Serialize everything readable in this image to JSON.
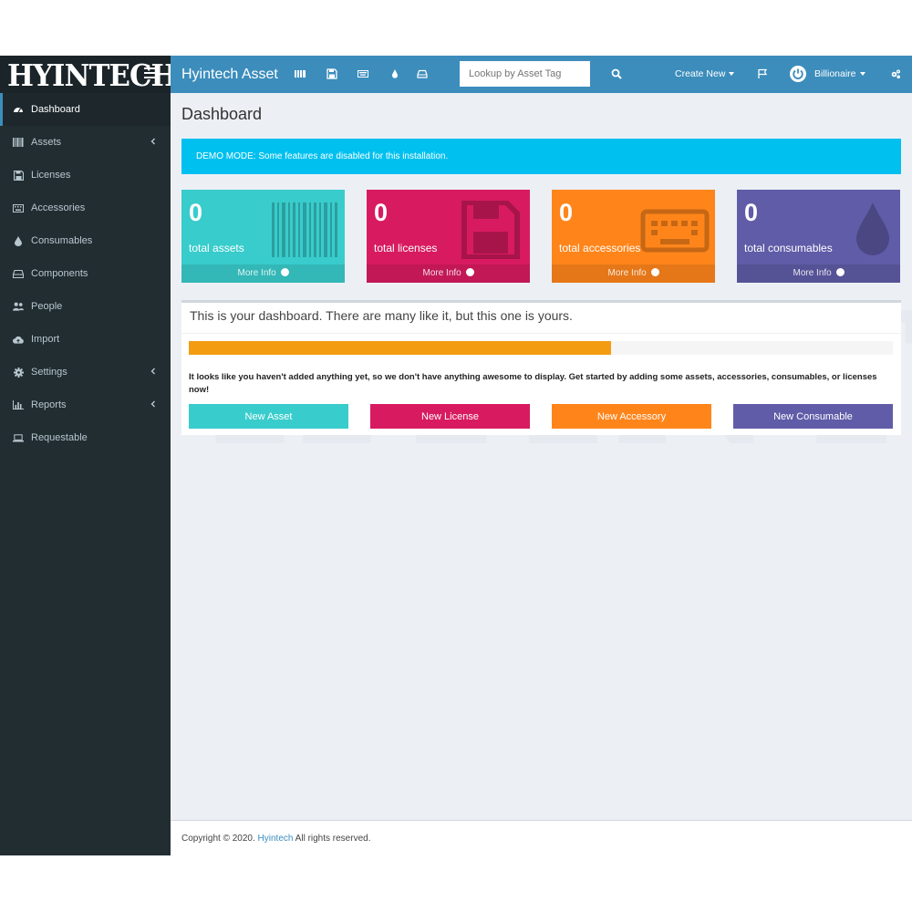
{
  "brand": {
    "logo_text": "HYINTECH",
    "app_title": "Hyintech Asset"
  },
  "colors": {
    "sidebar_bg": "#222d32",
    "header_bg": "#3c8dbc",
    "teal": "#39cccc",
    "pink": "#d81b60",
    "orange": "#ff851b",
    "purple": "#605ca8",
    "info": "#00c0ef",
    "progress": "#f39c12"
  },
  "sidebar": {
    "items": [
      {
        "label": "Dashboard",
        "icon": "dashboard-icon",
        "active": true,
        "has_chevron": false
      },
      {
        "label": "Assets",
        "icon": "barcode-icon",
        "active": false,
        "has_chevron": true
      },
      {
        "label": "Licenses",
        "icon": "floppy-icon",
        "active": false,
        "has_chevron": false
      },
      {
        "label": "Accessories",
        "icon": "keyboard-icon",
        "active": false,
        "has_chevron": false
      },
      {
        "label": "Consumables",
        "icon": "tint-icon",
        "active": false,
        "has_chevron": false
      },
      {
        "label": "Components",
        "icon": "hdd-icon",
        "active": false,
        "has_chevron": false
      },
      {
        "label": "People",
        "icon": "users-icon",
        "active": false,
        "has_chevron": false
      },
      {
        "label": "Import",
        "icon": "cloud-upload-icon",
        "active": false,
        "has_chevron": false
      },
      {
        "label": "Settings",
        "icon": "cog-icon",
        "active": false,
        "has_chevron": true
      },
      {
        "label": "Reports",
        "icon": "bar-chart-icon",
        "active": false,
        "has_chevron": true
      },
      {
        "label": "Requestable",
        "icon": "laptop-icon",
        "active": false,
        "has_chevron": false
      }
    ]
  },
  "header": {
    "search_placeholder": "Lookup by Asset Tag",
    "create_new": "Create New",
    "user": "Billionaire"
  },
  "main": {
    "title": "Dashboard",
    "demo_alert": "DEMO MODE: Some features are disabled for this installation.",
    "stat_boxes": [
      {
        "count": "0",
        "label": "total assets",
        "more": "More Info",
        "color": "#39cccc",
        "icon": "barcode-icon"
      },
      {
        "count": "0",
        "label": "total licenses",
        "more": "More Info",
        "color": "#d81b60",
        "icon": "floppy-icon"
      },
      {
        "count": "0",
        "label": "total accessories",
        "more": "More Info",
        "color": "#ff851b",
        "icon": "keyboard-icon"
      },
      {
        "count": "0",
        "label": "total consumables",
        "more": "More Info",
        "color": "#605ca8",
        "icon": "tint-icon"
      }
    ],
    "panel": {
      "title": "This is your dashboard. There are many like it, but this one is yours.",
      "progress": 0.6,
      "message": "It looks like you haven't added anything yet, so we don't have anything awesome to display. Get started by adding some assets, accessories, consumables, or licenses now!",
      "buttons": [
        "New Asset",
        "New License",
        "New Accessory",
        "New Consumable"
      ]
    }
  },
  "footer": {
    "prefix": "Copyright © 2020.",
    "link": "Hyintech",
    "suffix": "All rights reserved."
  }
}
